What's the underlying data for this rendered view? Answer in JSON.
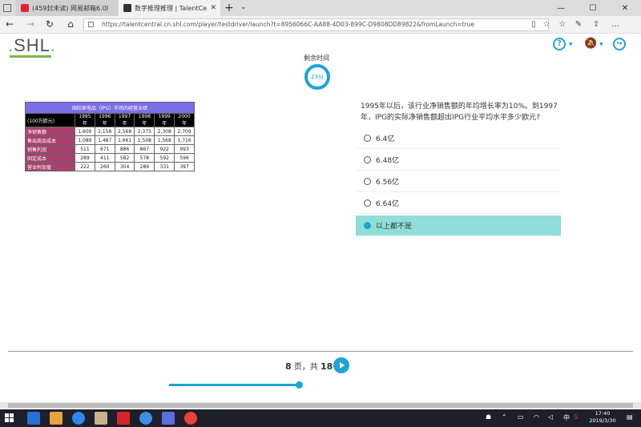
{
  "browser": {
    "tabs": [
      {
        "title": "(459封未读) 网易邮箱6.0版",
        "active": false
      },
      {
        "title": "数字推理推理 | TalentCe",
        "active": true
      }
    ],
    "url": "https://talentcentral.cn.shl.com/player/testdriver/launch?t=8956066C-AA88-4D03-899C-D9808DD89822&fromLaunch=true"
  },
  "header": {
    "logo_prefix": ".",
    "logo_text": "SHL",
    "logo_suffix": ".",
    "help_icon": "help-icon",
    "accent": "#1fa3d8"
  },
  "timer": {
    "label": "剩余时间",
    "value": "23分"
  },
  "table": {
    "title": "国际家电品（IPG）市场的经营业绩",
    "unit": "(100万欧元)",
    "years": [
      "1995 年",
      "1996 年",
      "1997 年",
      "1998 年",
      "1999 年",
      "2000 年"
    ],
    "rows": [
      {
        "label": "净销售额",
        "values": [
          "1,600",
          "2,158",
          "2,568",
          "2,375",
          "2,308",
          "2,709"
        ]
      },
      {
        "label": "售出商品成本",
        "values": [
          "1,089",
          "1,487",
          "1,661",
          "1,508",
          "1,568",
          "1,716"
        ]
      },
      {
        "label": "销售利润",
        "values": [
          "511",
          "671",
          "886",
          "867",
          "922",
          "993"
        ]
      },
      {
        "label": "固定成本",
        "values": [
          "289",
          "411",
          "582",
          "578",
          "592",
          "596"
        ]
      },
      {
        "label": "营业附加值",
        "values": [
          "222",
          "260",
          "304",
          "289",
          "331",
          "397"
        ]
      }
    ]
  },
  "question": {
    "text": "1995年以后，该行业净销售额的年均增长率为10%。到1997年，IPG的实际净销售额超出IPG行业平均水平多少欧元?",
    "options": [
      {
        "label": "6.4亿",
        "selected": false
      },
      {
        "label": "6.48亿",
        "selected": false
      },
      {
        "label": "6.56亿",
        "selected": false
      },
      {
        "label": "6.64亿",
        "selected": false
      },
      {
        "label": "以上都不是",
        "selected": true
      }
    ]
  },
  "pager": {
    "current": "8",
    "mid": "页，共",
    "total": "18",
    "progress": 0.44
  },
  "taskbar": {
    "ime": "中",
    "time": "17:40",
    "date": "2019/3/30"
  }
}
